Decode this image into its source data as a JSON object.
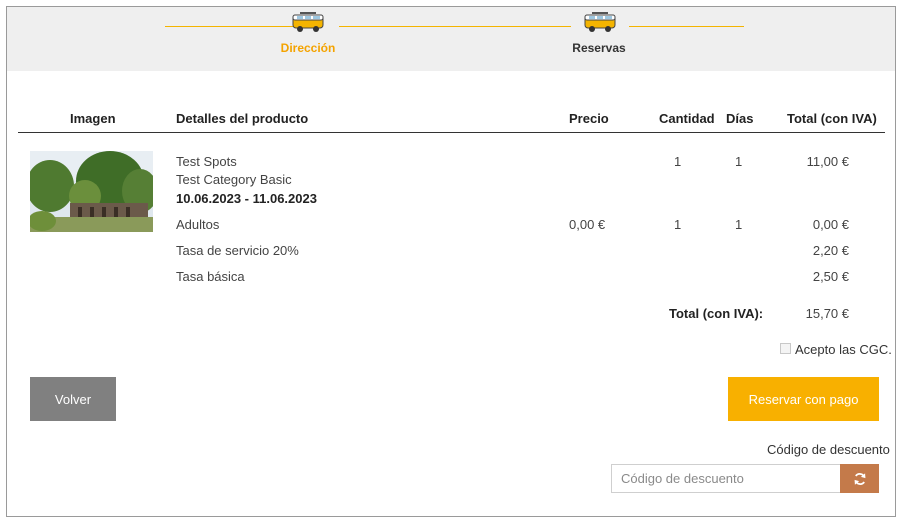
{
  "steps": [
    {
      "label": "Dirección",
      "active": true
    },
    {
      "label": "Reservas",
      "active": false
    }
  ],
  "colors": {
    "accent": "#f4b400",
    "back_button": "#808080",
    "pay_button": "#f8b000",
    "refresh_button": "#c47a4a"
  },
  "table": {
    "headers": {
      "image": "Imagen",
      "details": "Detalles del producto",
      "price": "Precio",
      "quantity": "Cantidad",
      "days": "Días",
      "total": "Total (con IVA)"
    },
    "product": {
      "name": "Test Spots",
      "category": "Test Category Basic",
      "dates": "10.06.2023 - 11.06.2023",
      "quantity": "1",
      "days": "1",
      "total": "11,00 €"
    },
    "lines": [
      {
        "label": "Adultos",
        "price": "0,00 €",
        "quantity": "1",
        "days": "1",
        "total": "0,00 €"
      },
      {
        "label": "Tasa de servicio 20%",
        "total": "2,20 €"
      },
      {
        "label": "Tasa básica",
        "total": "2,50 €"
      }
    ],
    "grand_total_label": "Total (con IVA):",
    "grand_total": "15,70 €"
  },
  "terms": {
    "label": "Acepto las CGC.",
    "checked": false
  },
  "buttons": {
    "back": "Volver",
    "pay": "Reservar con pago"
  },
  "discount": {
    "label": "Código de descuento",
    "placeholder": "Código de descuento",
    "value": ""
  },
  "icons": {
    "step": "van-icon",
    "refresh": "refresh-icon"
  }
}
